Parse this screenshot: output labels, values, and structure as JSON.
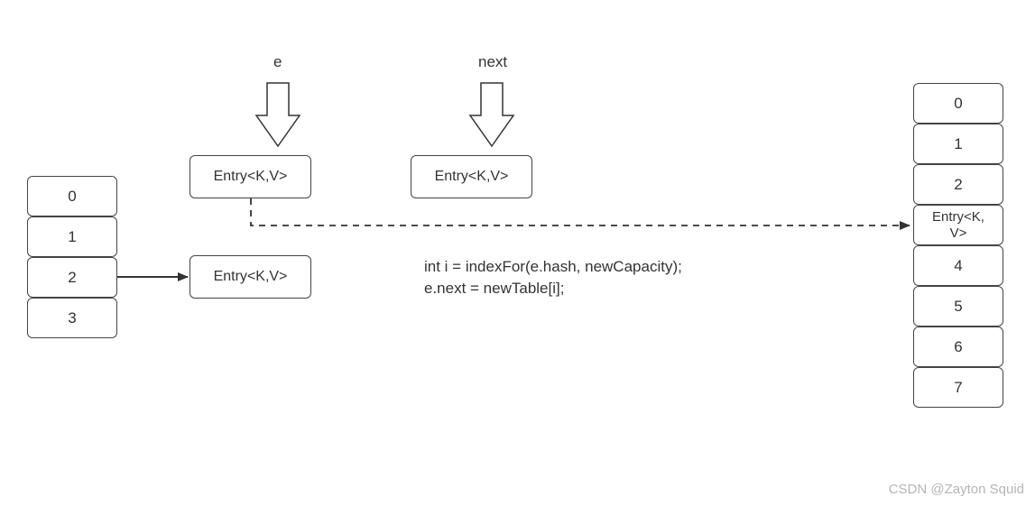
{
  "labels": {
    "e": "e",
    "next": "next"
  },
  "leftTable": [
    "0",
    "1",
    "2",
    "3"
  ],
  "entries": {
    "eBox": "Entry<K,V>",
    "nextBox": "Entry<K,V>",
    "chainBox": "Entry<K,V>"
  },
  "rightTable": [
    "0",
    "1",
    "2",
    "Entry<K,\nV>",
    "4",
    "5",
    "6",
    "7"
  ],
  "code": {
    "line1": "int i = indexFor(e.hash, newCapacity);",
    "line2": "e.next = newTable[i];"
  },
  "watermark": "CSDN @Zayton Squid"
}
